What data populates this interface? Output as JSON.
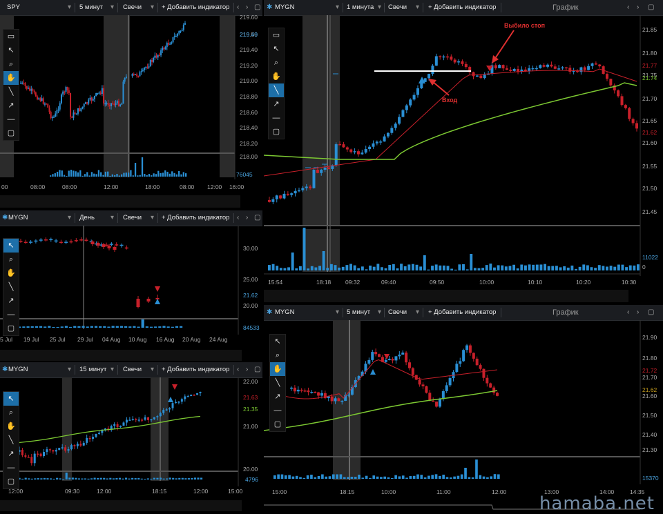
{
  "panels": {
    "spy": {
      "symbol": "SPY",
      "interval": "5 минут",
      "type": "Свечи",
      "add": "+ Добавить индикатор",
      "prices": [
        "219.60",
        "219.50",
        "219.40",
        "219.20",
        "219.00",
        "218.80",
        "218.60",
        "218.40",
        "218.20",
        "218.00"
      ],
      "price_highlight": "219.49",
      "volume_label": "76045",
      "time_labels": [
        "00",
        "08:00",
        "08:00",
        "12:00",
        "18:00",
        "08:00",
        "12:00",
        "16:00"
      ]
    },
    "mygn_day": {
      "symbol": "MYGN",
      "interval": "День",
      "type": "Свечи",
      "add": "+ Добавить индикатор",
      "prices": [
        "30.00",
        "25.00",
        "21.62",
        "20.00"
      ],
      "volume_label": "84533",
      "time_labels": [
        "5 Jul",
        "19 Jul",
        "25 Jul",
        "29 Jul",
        "04 Aug",
        "10 Aug",
        "16 Aug",
        "20 Aug",
        "24 Aug"
      ]
    },
    "mygn_15": {
      "symbol": "MYGN",
      "interval": "15 минут",
      "type": "Свечи",
      "add": "+ Добавить индикатор",
      "prices": [
        "22.00",
        "21.63",
        "21.35",
        "21.00",
        "20.00"
      ],
      "volume_label": "4796",
      "time_labels": [
        "12:00",
        "09:30",
        "12:00",
        "18:15",
        "12:00",
        "15:00"
      ]
    },
    "mygn_1": {
      "symbol": "MYGN",
      "interval": "1 минута",
      "type": "Свечи",
      "add": "+ Добавить индикатор",
      "window_title": "График",
      "prices": [
        "21.85",
        "21.80",
        "21.75",
        "21.70",
        "21.65",
        "21.60",
        "21.55",
        "21.50",
        "21.45"
      ],
      "price_red": "21.77",
      "price_green": "21.74",
      "price_last": "21.62",
      "volume_label": "11022",
      "volume_zero": "0",
      "time_labels": [
        "15:54",
        "18:18",
        "09:32",
        "09:40",
        "09:50",
        "10:00",
        "10:10",
        "10:20",
        "10:30"
      ],
      "annot_stop": "Выбило стоп",
      "annot_entry": "Вход"
    },
    "mygn_5": {
      "symbol": "MYGN",
      "interval": "5 минут",
      "type": "Свечи",
      "add": "+ Добавить индикатор",
      "window_title": "График",
      "prices": [
        "21.90",
        "21.80",
        "21.72",
        "21.70",
        "21.62",
        "21.60",
        "21.50",
        "21.40",
        "21.30"
      ],
      "volume_label": "15370",
      "time_labels": [
        "15:00",
        "18:15",
        "10:00",
        "11:00",
        "12:00",
        "13:00",
        "14:00",
        "14:35"
      ]
    }
  },
  "toolbar_icons": [
    "menu-icon",
    "cursor-icon",
    "zoom-icon",
    "hand-icon",
    "line-icon",
    "arrow-icon",
    "hline-icon",
    "rect-icon"
  ],
  "watermark": "hamaba.net",
  "colors": {
    "up": "#2a8fd4",
    "down": "#c8202a",
    "ema_red": "#c8202a",
    "ema_green": "#7cc832"
  }
}
